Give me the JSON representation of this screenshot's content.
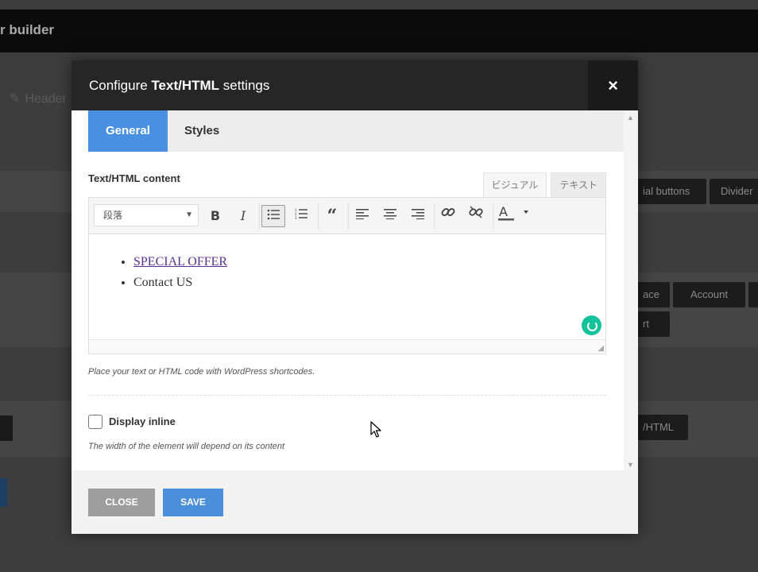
{
  "app": {
    "title": "r builder",
    "header_label": "Header"
  },
  "background_buttons": {
    "social_buttons": "ial buttons",
    "divider": "Divider",
    "place": "ace",
    "account": "Account",
    "cart": "rt",
    "text_html": "/HTML"
  },
  "modal": {
    "title_prefix": "Configure ",
    "title_bold": "Text/HTML",
    "title_suffix": " settings",
    "close_symbol": "×",
    "tabs": [
      {
        "label": "General",
        "active": true
      },
      {
        "label": "Styles",
        "active": false
      }
    ],
    "content_label": "Text/HTML content",
    "mode_tabs": {
      "visual": "ビジュアル",
      "text": "テキスト"
    },
    "toolbar": {
      "format_value": "段落",
      "icons": [
        "bold-icon",
        "italic-icon",
        "bullet-list-icon",
        "numbered-list-icon",
        "blockquote-icon",
        "align-left-icon",
        "align-center-icon",
        "align-right-icon",
        "link-icon",
        "unlink-icon",
        "text-color-icon"
      ]
    },
    "editor_items": [
      {
        "text": "SPECIAL OFFER",
        "link": true
      },
      {
        "text": "Contact US",
        "link": false
      }
    ],
    "help_text": "Place your text or HTML code with WordPress shortcodes.",
    "display_inline": {
      "label": "Display inline",
      "checked": false,
      "help": "The width of the element will depend on its content"
    },
    "buttons": {
      "close": "CLOSE",
      "save": "SAVE"
    }
  },
  "colors": {
    "accent": "#4a90e2",
    "header_bg": "#262626",
    "overlay": "#3d3d3d"
  }
}
